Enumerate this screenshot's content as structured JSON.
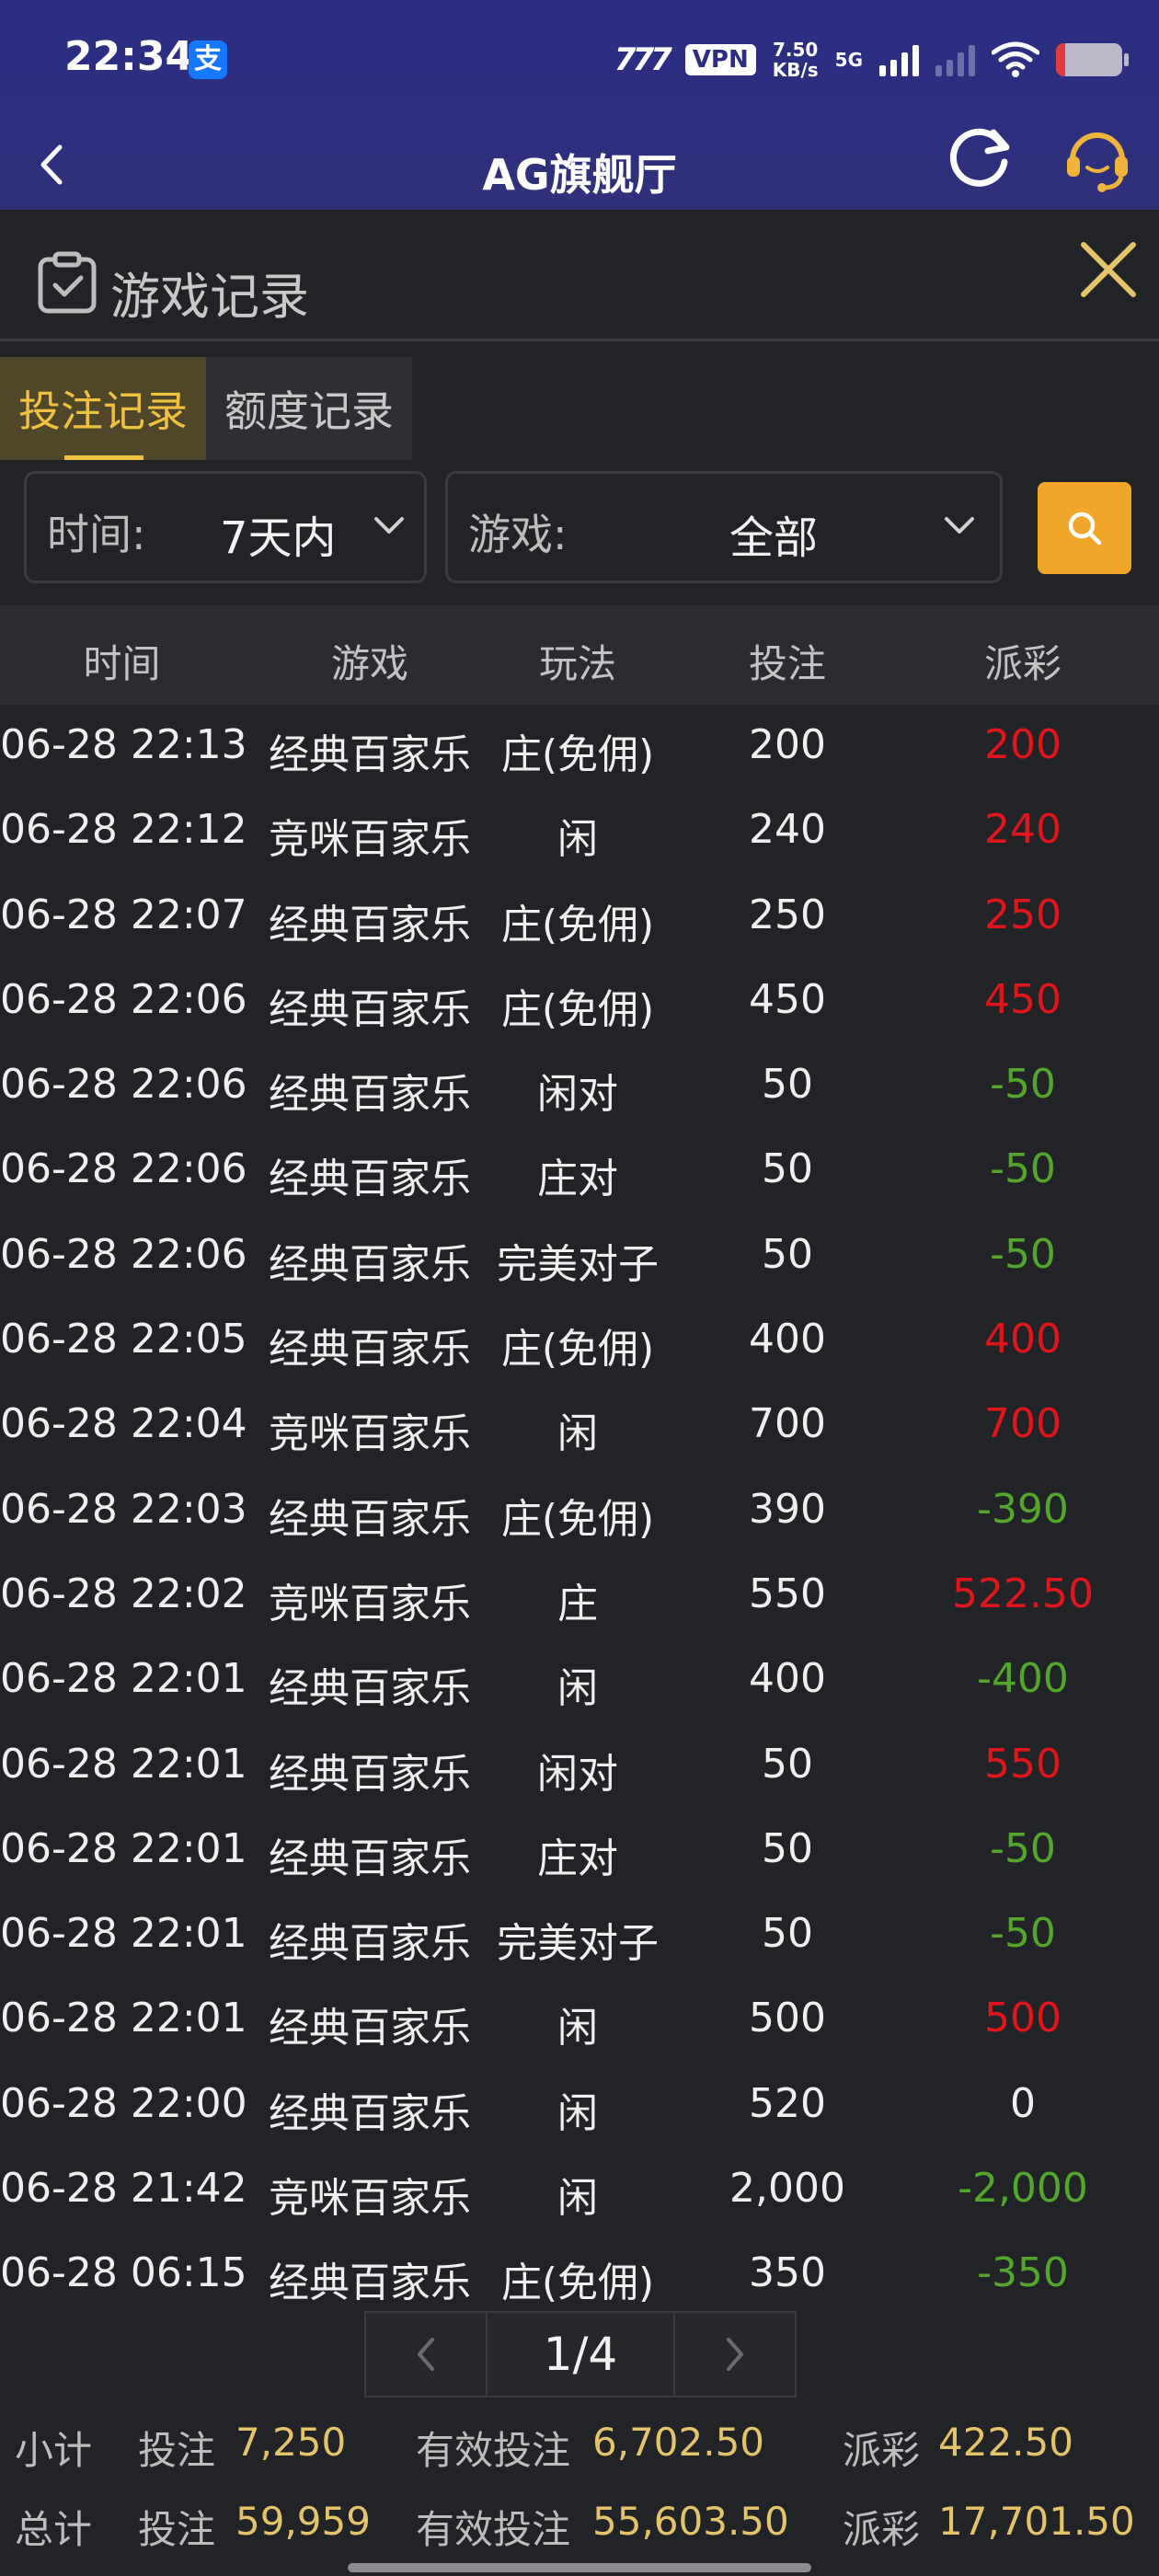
{
  "status_bar": {
    "time": "22:34",
    "alipay_icon": "支",
    "signal_text": "777",
    "vpn": "VPN",
    "speed_value": "7.50",
    "speed_unit": "KB/s",
    "network": "5G"
  },
  "header": {
    "title": "AG旗舰厅"
  },
  "section": {
    "title": "游戏记录"
  },
  "tabs": [
    {
      "label": "投注记录",
      "active": true
    },
    {
      "label": "额度记录",
      "active": false
    }
  ],
  "filters": {
    "time_label": "时间:",
    "time_value": "7天内",
    "game_label": "游戏:",
    "game_value": "全部"
  },
  "table": {
    "headers": [
      "时间",
      "游戏",
      "玩法",
      "投注",
      "派彩"
    ],
    "rows": [
      {
        "time": "06-28 22:13",
        "game": "经典百家乐",
        "play": "庄(免佣)",
        "bet": "200",
        "payout": "200",
        "result": "win"
      },
      {
        "time": "06-28 22:12",
        "game": "竞咪百家乐",
        "play": "闲",
        "bet": "240",
        "payout": "240",
        "result": "win"
      },
      {
        "time": "06-28 22:07",
        "game": "经典百家乐",
        "play": "庄(免佣)",
        "bet": "250",
        "payout": "250",
        "result": "win"
      },
      {
        "time": "06-28 22:06",
        "game": "经典百家乐",
        "play": "庄(免佣)",
        "bet": "450",
        "payout": "450",
        "result": "win"
      },
      {
        "time": "06-28 22:06",
        "game": "经典百家乐",
        "play": "闲对",
        "bet": "50",
        "payout": "-50",
        "result": "lose"
      },
      {
        "time": "06-28 22:06",
        "game": "经典百家乐",
        "play": "庄对",
        "bet": "50",
        "payout": "-50",
        "result": "lose"
      },
      {
        "time": "06-28 22:06",
        "game": "经典百家乐",
        "play": "完美对子",
        "bet": "50",
        "payout": "-50",
        "result": "lose"
      },
      {
        "time": "06-28 22:05",
        "game": "经典百家乐",
        "play": "庄(免佣)",
        "bet": "400",
        "payout": "400",
        "result": "win"
      },
      {
        "time": "06-28 22:04",
        "game": "竞咪百家乐",
        "play": "闲",
        "bet": "700",
        "payout": "700",
        "result": "win"
      },
      {
        "time": "06-28 22:03",
        "game": "经典百家乐",
        "play": "庄(免佣)",
        "bet": "390",
        "payout": "-390",
        "result": "lose"
      },
      {
        "time": "06-28 22:02",
        "game": "竞咪百家乐",
        "play": "庄",
        "bet": "550",
        "payout": "522.50",
        "result": "win"
      },
      {
        "time": "06-28 22:01",
        "game": "经典百家乐",
        "play": "闲",
        "bet": "400",
        "payout": "-400",
        "result": "lose"
      },
      {
        "time": "06-28 22:01",
        "game": "经典百家乐",
        "play": "闲对",
        "bet": "50",
        "payout": "550",
        "result": "win"
      },
      {
        "time": "06-28 22:01",
        "game": "经典百家乐",
        "play": "庄对",
        "bet": "50",
        "payout": "-50",
        "result": "lose"
      },
      {
        "time": "06-28 22:01",
        "game": "经典百家乐",
        "play": "完美对子",
        "bet": "50",
        "payout": "-50",
        "result": "lose"
      },
      {
        "time": "06-28 22:01",
        "game": "经典百家乐",
        "play": "闲",
        "bet": "500",
        "payout": "500",
        "result": "win"
      },
      {
        "time": "06-28 22:00",
        "game": "经典百家乐",
        "play": "闲",
        "bet": "520",
        "payout": "0",
        "result": "zero"
      },
      {
        "time": "06-28 21:42",
        "game": "竞咪百家乐",
        "play": "闲",
        "bet": "2,000",
        "payout": "-2,000",
        "result": "lose"
      },
      {
        "time": "06-28 06:15",
        "game": "经典百家乐",
        "play": "庄(免佣)",
        "bet": "350",
        "payout": "-350",
        "result": "lose"
      }
    ]
  },
  "pagination": {
    "page_text": "1/4"
  },
  "subtotal": {
    "label": "小计",
    "bet_label": "投注",
    "bet_value": "7,250",
    "valid_label": "有效投注",
    "valid_value": "6,702.50",
    "payout_label": "派彩",
    "payout_value": "422.50"
  },
  "total": {
    "label": "总计",
    "bet_label": "投注",
    "bet_value": "59,959",
    "valid_label": "有效投注",
    "valid_value": "55,603.50",
    "payout_label": "派彩",
    "payout_value": "17,701.50"
  },
  "colors": {
    "header_bg": "#2b2d83",
    "accent": "#f0c040",
    "search_button": "#f0a62a",
    "win": "#e0161c",
    "lose": "#52a62b"
  },
  "icons": {
    "back": "chevron-left-icon",
    "refresh": "refresh-icon",
    "support": "headset-icon",
    "section": "clipboard-check-icon",
    "close": "close-icon",
    "dropdown": "chevron-down-icon",
    "search": "search-icon",
    "prev": "chevron-left-icon",
    "next": "chevron-right-icon"
  }
}
